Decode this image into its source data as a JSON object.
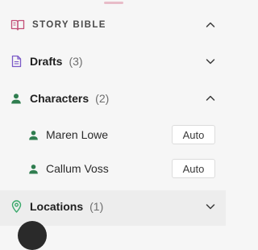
{
  "story_bible": {
    "title": "STORY BIBLE",
    "icon": "book-open-icon",
    "expanded": true
  },
  "sections": {
    "drafts": {
      "label": "Drafts",
      "count": "(3)",
      "icon": "document-icon",
      "expanded": false
    },
    "characters": {
      "label": "Characters",
      "count": "(2)",
      "icon": "person-icon",
      "expanded": true
    },
    "locations": {
      "label": "Locations",
      "count": "(1)",
      "icon": "map-pin-icon",
      "expanded": false
    }
  },
  "characters": [
    {
      "name": "Maren Lowe",
      "button": "Auto"
    },
    {
      "name": "Callum Voss",
      "button": "Auto"
    }
  ],
  "colors": {
    "story_bible_icon": "#c24e76",
    "drafts_icon": "#7b5ac7",
    "characters_icon": "#2f7d4f",
    "locations_icon": "#3aa96b",
    "handle": "#e8bcc8"
  }
}
